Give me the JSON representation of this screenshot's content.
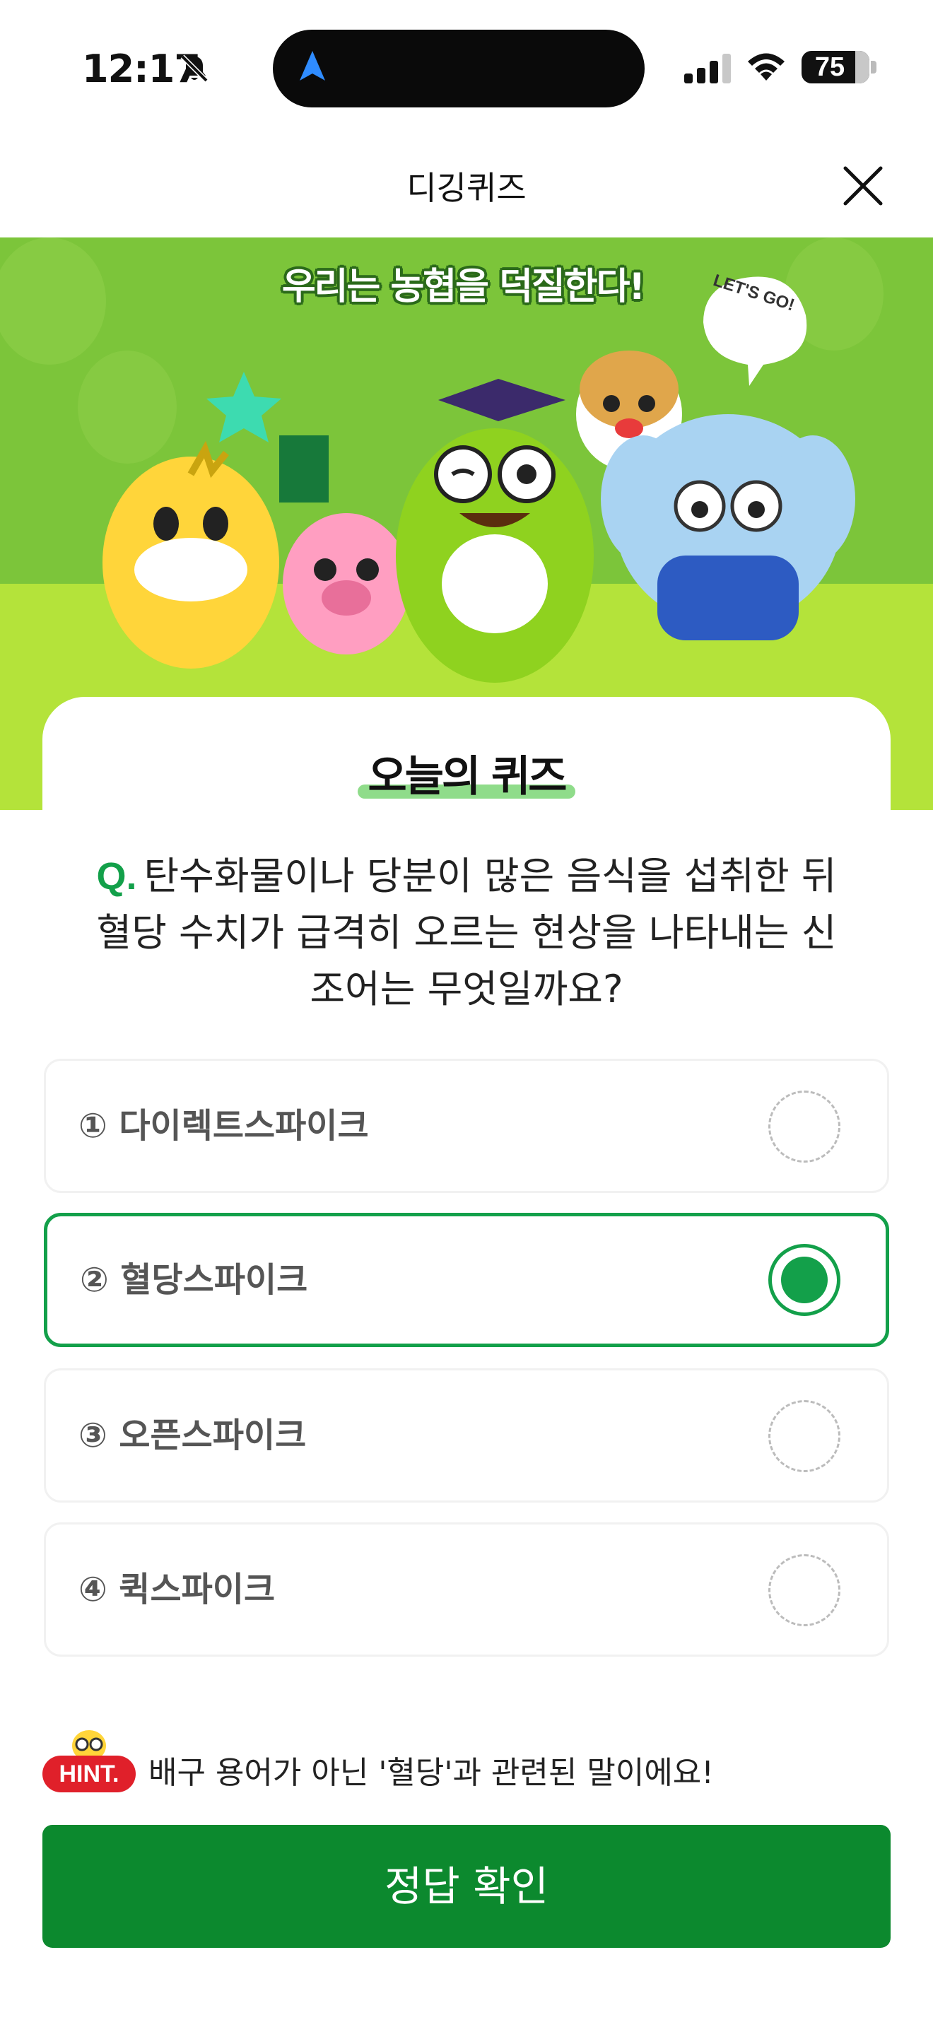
{
  "status_bar": {
    "time": "12:17",
    "battery": "75",
    "icons": [
      "bell-slash-icon",
      "location-arrow-icon",
      "signal-icon",
      "wifi-icon",
      "battery-icon"
    ]
  },
  "header": {
    "title": "디깅퀴즈",
    "close_icon": "close-icon"
  },
  "banner": {
    "slogan": "우리는 농협을 덕질한다!",
    "bubble_text": "LET'S GO!"
  },
  "quiz": {
    "title": "오늘의 퀴즈",
    "question_mark": "Q.",
    "question": "탄수화물이나 당분이 많은 음식을 섭취한 뒤 혈당 수치가 급격히 오르는 현상을 나타내는 신조어는 무엇일까요?",
    "options": [
      {
        "label": "① 다이렉트스파이크",
        "selected": false
      },
      {
        "label": "② 혈당스파이크",
        "selected": true
      },
      {
        "label": "③ 오픈스파이크",
        "selected": false
      },
      {
        "label": "④ 퀵스파이크",
        "selected": false
      }
    ]
  },
  "hint": {
    "badge": "HINT.",
    "text": "배구 용어가 아닌 '혈당'과 관련된 말이에요!"
  },
  "confirm_button": "정답 확인",
  "colors": {
    "accent_green": "#13a04a",
    "button_green": "#0c892e",
    "banner_green": "#7cc53a",
    "hint_red": "#e0202a"
  }
}
